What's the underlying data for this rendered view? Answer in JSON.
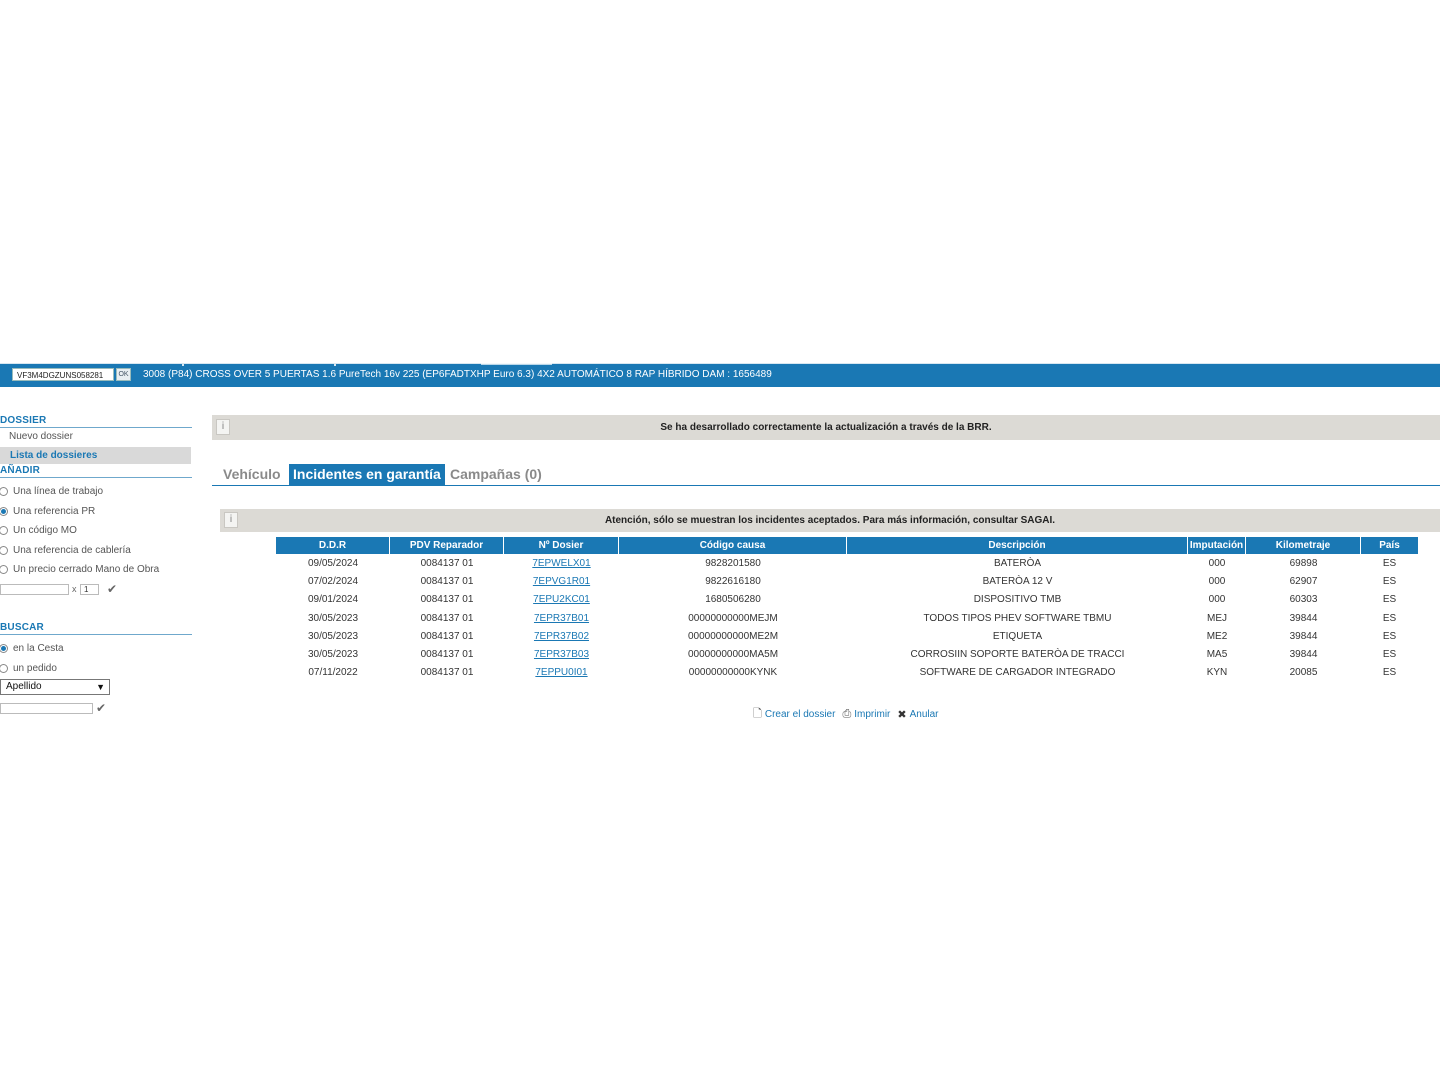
{
  "vehicle_bar": {
    "vin": "VF3M4DGZUNS058281",
    "ok_label": "OK",
    "description": "3008 (P84) CROSS OVER 5 PUERTAS 1.6 PureTech 16v 225 (EP6FADTXHP Euro 6.3) 4X2 AUTOMÁTICO 8 RAP HÍBRIDO  DAM : 1656489"
  },
  "sidebar": {
    "dossier": {
      "title": "DOSSIER",
      "items": [
        {
          "label": "Nuevo dossier"
        },
        {
          "label": "Lista de dossieres"
        }
      ]
    },
    "anadir": {
      "title": "AÑADIR",
      "options": [
        {
          "label": "Una línea de trabajo",
          "selected": false
        },
        {
          "label": "Una referencia PR",
          "selected": true
        },
        {
          "label": "Un código MO",
          "selected": false
        },
        {
          "label": "Una referencia de cablería",
          "selected": false
        },
        {
          "label": "Un precio cerrado Mano de Obra",
          "selected": false
        }
      ],
      "qty_separator": "x",
      "qty_value": "1"
    },
    "buscar": {
      "title": "BUSCAR",
      "options": [
        {
          "label": "en la Cesta",
          "selected": true
        },
        {
          "label": "un pedido",
          "selected": false
        }
      ],
      "select_value": "Apellido"
    }
  },
  "banners": {
    "success": "Se ha desarrollado correctamente la actualización a través de la BRR.",
    "warning": "Atención, sólo se muestran los incidentes aceptados. Para más información, consultar SAGAI."
  },
  "tabs": [
    {
      "label": "Vehículo",
      "active": false
    },
    {
      "label": "Incidentes en garantía",
      "active": true
    },
    {
      "label": "Campañas (0)",
      "active": false
    }
  ],
  "table": {
    "headers": [
      "D.D.R",
      "PDV Reparador",
      "Nº Dosier",
      "Código causa",
      "Descripción",
      "Imputación",
      "Kilometraje",
      "País"
    ],
    "rows": [
      [
        "09/05/2024",
        "0084137 01",
        "7EPWELX01",
        "9828201580",
        "BATERÒA",
        "000",
        "69898",
        "ES"
      ],
      [
        "07/02/2024",
        "0084137 01",
        "7EPVG1R01",
        "9822616180",
        "BATERÒA 12 V",
        "000",
        "62907",
        "ES"
      ],
      [
        "09/01/2024",
        "0084137 01",
        "7EPU2KC01",
        "1680506280",
        "DISPOSITIVO TMB",
        "000",
        "60303",
        "ES"
      ],
      [
        "30/05/2023",
        "0084137 01",
        "7EPR37B01",
        "00000000000MEJM",
        "TODOS TIPOS PHEV SOFTWARE TBMU",
        "MEJ",
        "39844",
        "ES"
      ],
      [
        "30/05/2023",
        "0084137 01",
        "7EPR37B02",
        "00000000000ME2M",
        "ETIQUETA",
        "ME2",
        "39844",
        "ES"
      ],
      [
        "30/05/2023",
        "0084137 01",
        "7EPR37B03",
        "00000000000MA5M",
        "CORROSIIN SOPORTE BATERÒA DE TRACCI",
        "MA5",
        "39844",
        "ES"
      ],
      [
        "07/11/2022",
        "0084137 01",
        "7EPPU0I01",
        "00000000000KYNK",
        "SOFTWARE DE CARGADOR INTEGRADO",
        "KYN",
        "20085",
        "ES"
      ]
    ]
  },
  "actions": [
    {
      "label": "Crear el dossier",
      "icon": "new-document-icon"
    },
    {
      "label": "Imprimir",
      "icon": "printer-icon"
    },
    {
      "label": "Anular",
      "icon": "close-icon"
    }
  ],
  "colors": {
    "brand_blue": "#1a78b4",
    "banner_gray": "#dcdad5"
  }
}
